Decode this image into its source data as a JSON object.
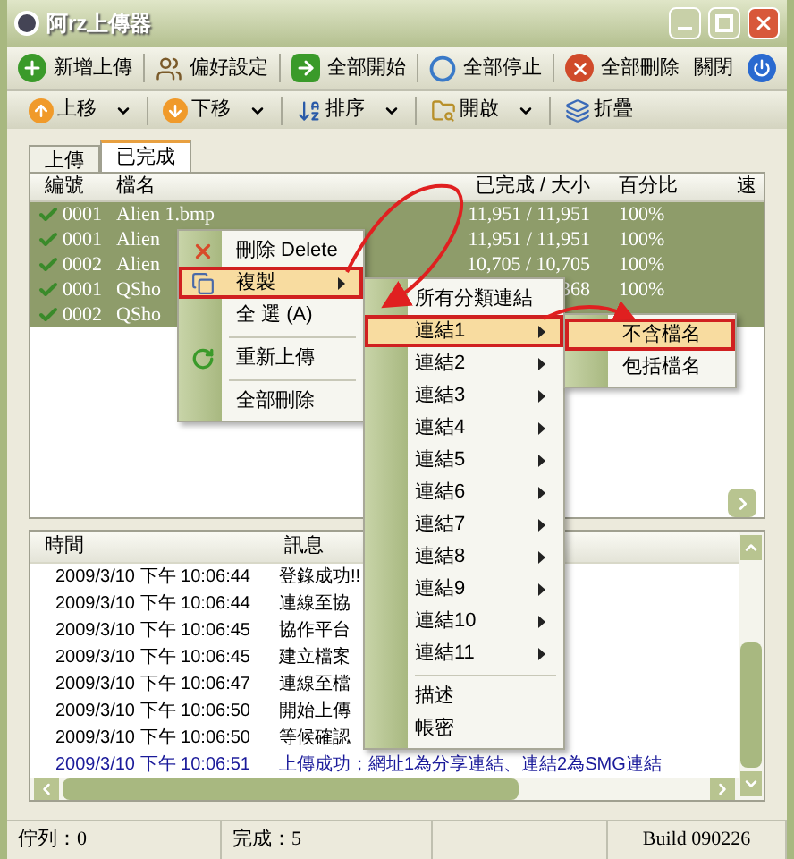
{
  "window": {
    "title": "阿rz上傳器"
  },
  "toolbar": [
    {
      "label": "新增上傳",
      "kind": "add"
    },
    {
      "label": "偏好設定",
      "kind": "users"
    },
    {
      "label": "全部開始",
      "kind": "start"
    },
    {
      "label": "全部停止",
      "kind": "stop"
    },
    {
      "label": "全部刪除",
      "kind": "delete"
    },
    {
      "label": "關閉",
      "kind": "plain"
    },
    {
      "kind": "power"
    }
  ],
  "toolbar2": [
    {
      "label": "上移",
      "kind": "up",
      "dropdown": true
    },
    {
      "label": "下移",
      "kind": "down",
      "dropdown": true
    },
    {
      "label": "排序",
      "kind": "sort",
      "dropdown": true
    },
    {
      "label": "開啟",
      "kind": "open",
      "dropdown": true
    },
    {
      "label": "折疊",
      "kind": "fold",
      "dropdown": false
    }
  ],
  "tabs": [
    {
      "label": "上傳",
      "selected": false
    },
    {
      "label": "已完成",
      "selected": true
    }
  ],
  "file_list": {
    "columns": [
      "編號",
      "檔名",
      "已完成 / 大小",
      "百分比",
      "速"
    ],
    "rows": [
      {
        "id": "0001",
        "name": "Alien 1.bmp",
        "size": "11,951 / 11,951",
        "percent": "100%",
        "selected": true
      },
      {
        "id": "0001",
        "name": "Alien",
        "size": "11,951 / 11,951",
        "percent": "100%",
        "selected": true
      },
      {
        "id": "0002",
        "name": "Alien",
        "size": "10,705 / 10,705",
        "percent": "100%",
        "selected": true
      },
      {
        "id": "0001",
        "name": "QSho",
        "size": "368",
        "percent": "100%",
        "selected": true
      },
      {
        "id": "0002",
        "name": "QSho",
        "selected": true
      }
    ]
  },
  "context_menu": [
    {
      "kind": "delete",
      "label": "刪除 Delete",
      "submenu": false,
      "selected": false
    },
    {
      "kind": "copy",
      "label": "複製",
      "submenu": true,
      "selected": true
    },
    {
      "kind": "item",
      "label": "全 選 (A)",
      "submenu": false,
      "selected": false
    },
    {
      "kind": "separator"
    },
    {
      "kind": "reupload",
      "label": "重新上傳",
      "submenu": false,
      "selected": false
    },
    {
      "kind": "separator"
    },
    {
      "kind": "item",
      "label": "全部刪除",
      "submenu": false,
      "selected": false
    }
  ],
  "copy_submenu": [
    {
      "kind": "item",
      "label": "所有分類連結",
      "submenu": false,
      "selected": false
    },
    {
      "kind": "item",
      "label": "連結1",
      "submenu": true,
      "selected": true
    },
    {
      "kind": "item",
      "label": "連結2",
      "submenu": true,
      "selected": false
    },
    {
      "kind": "item",
      "label": "連結3",
      "submenu": true,
      "selected": false
    },
    {
      "kind": "item",
      "label": "連結4",
      "submenu": true,
      "selected": false
    },
    {
      "kind": "item",
      "label": "連結5",
      "submenu": true,
      "selected": false
    },
    {
      "kind": "item",
      "label": "連結6",
      "submenu": true,
      "selected": false
    },
    {
      "kind": "item",
      "label": "連結7",
      "submenu": true,
      "selected": false
    },
    {
      "kind": "item",
      "label": "連結8",
      "submenu": true,
      "selected": false
    },
    {
      "kind": "item",
      "label": "連結9",
      "submenu": true,
      "selected": false
    },
    {
      "kind": "item",
      "label": "連結10",
      "submenu": true,
      "selected": false
    },
    {
      "kind": "item",
      "label": "連結11",
      "submenu": true,
      "selected": false
    },
    {
      "kind": "separator"
    },
    {
      "kind": "item",
      "label": "描述",
      "submenu": false,
      "selected": false
    },
    {
      "kind": "item",
      "label": "帳密",
      "submenu": false,
      "selected": false
    }
  ],
  "link_submenu": [
    {
      "kind": "item",
      "label": "不含檔名",
      "submenu": false,
      "selected": true
    },
    {
      "kind": "item",
      "label": "包括檔名",
      "submenu": false,
      "selected": false
    }
  ],
  "log": {
    "columns": [
      "時間",
      "訊息"
    ],
    "rows": [
      {
        "time": "2009/3/10 下午 10:06:44",
        "message": "登錄成功!!",
        "kind": "normal"
      },
      {
        "time": "2009/3/10 下午 10:06:44",
        "message": "連線至協",
        "kind": "normal"
      },
      {
        "time": "2009/3/10 下午 10:06:45",
        "message": "協作平台",
        "kind": "normal"
      },
      {
        "time": "2009/3/10 下午 10:06:45",
        "message": "建立檔案",
        "kind": "normal"
      },
      {
        "time": "2009/3/10 下午 10:06:47",
        "message": "連線至檔",
        "kind": "normal"
      },
      {
        "time": "2009/3/10 下午 10:06:50",
        "message": "開始上傳",
        "kind": "normal"
      },
      {
        "time": "2009/3/10 下午 10:06:50",
        "message": "等候確認",
        "kind": "normal"
      },
      {
        "time": "2009/3/10 下午 10:06:51",
        "message": "上傳成功；網址1為分享連結、連結2為SMG連結",
        "kind": "success"
      }
    ]
  },
  "status_bar": [
    "佇列：0",
    "完成：5",
    "Build 090226"
  ]
}
